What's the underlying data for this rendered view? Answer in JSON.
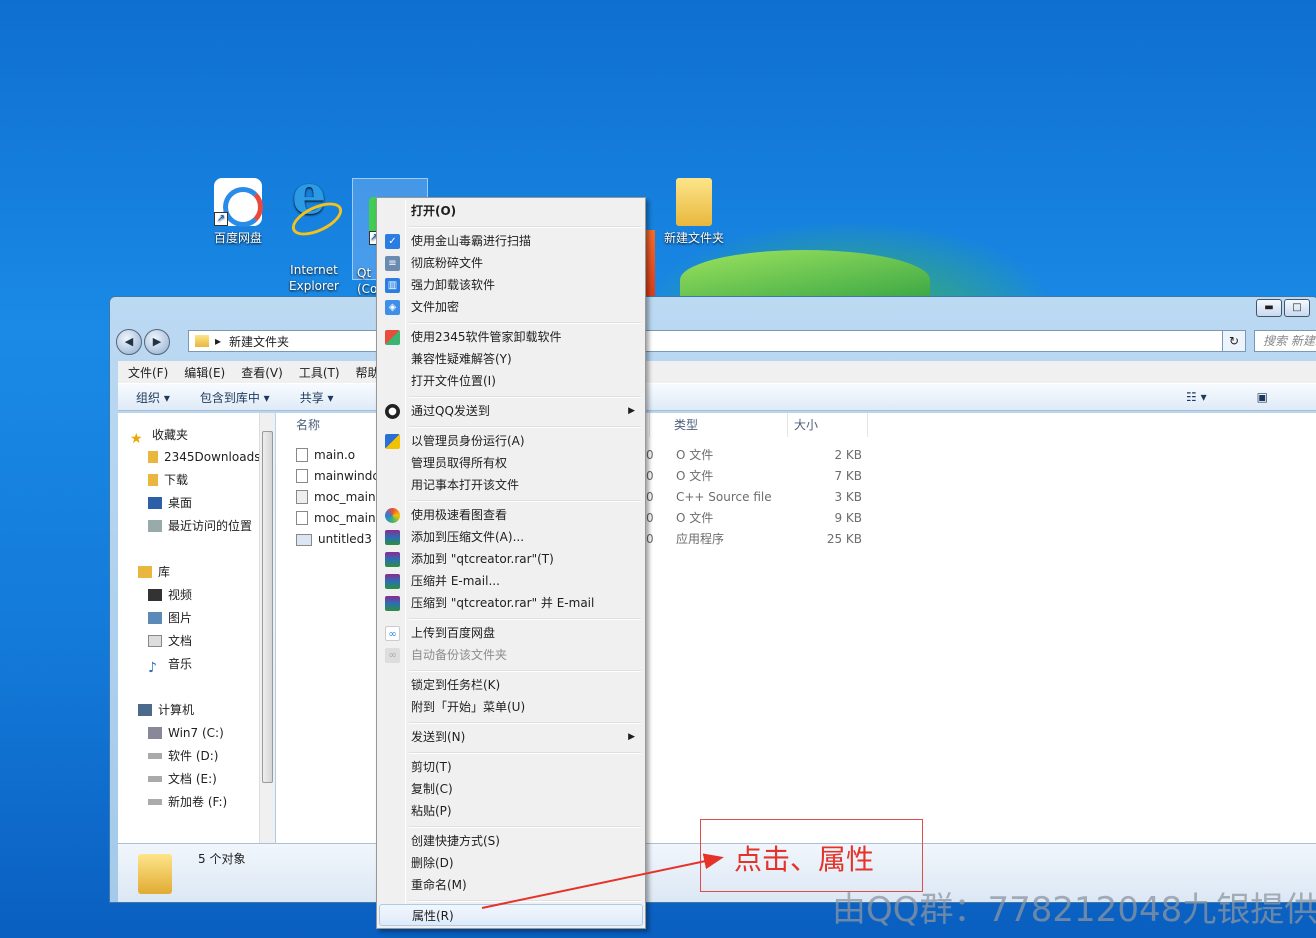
{
  "desktop": {
    "icons": [
      {
        "label": "百度网盘"
      },
      {
        "label": "Internet\nExplorer"
      },
      {
        "label": "Qt\n(Co"
      },
      {
        "label": "新建文件夹"
      }
    ]
  },
  "window": {
    "address_folder": "新建文件夹",
    "search_placeholder": "搜索 新建...",
    "controls": {
      "minimize": "▬",
      "maximize": "□"
    },
    "refresh_glyph": "↻",
    "menubar": [
      "文件(F)",
      "编辑(E)",
      "查看(V)",
      "工具(T)",
      "帮助("
    ],
    "toolbar": [
      "组织 ▾",
      "包含到库中 ▾",
      "共享 ▾"
    ],
    "nav": {
      "favorites": "收藏夹",
      "fav_items": [
        "2345Downloads",
        "下载",
        "桌面",
        "最近访问的位置"
      ],
      "library": "库",
      "lib_items": [
        "视频",
        "图片",
        "文档",
        "音乐"
      ],
      "computer": "计算机",
      "drives": [
        "Win7 (C:)",
        "软件 (D:)",
        "文档 (E:)",
        "新加卷 (F:)"
      ]
    },
    "columns": {
      "name": "名称",
      "type": "类型",
      "size": "大小"
    },
    "files": [
      {
        "name": "main.o",
        "date": "0",
        "type": "O 文件",
        "size": "2 KB"
      },
      {
        "name": "mainwindc",
        "date": "0",
        "type": "O 文件",
        "size": "7 KB"
      },
      {
        "name": "moc_mainv",
        "date": "0",
        "type": "C++ Source file",
        "size": "3 KB"
      },
      {
        "name": "moc_mainv",
        "date": "0",
        "type": "O 文件",
        "size": "9 KB"
      },
      {
        "name": "untitled3",
        "date": "0",
        "type": "应用程序",
        "size": "25 KB"
      }
    ],
    "status": "5 个对象"
  },
  "context_menu": {
    "open": "打开(O)",
    "g1": [
      "使用金山毒霸进行扫描",
      "彻底粉碎文件",
      "强力卸载该软件",
      "文件加密"
    ],
    "g2": [
      "使用2345软件管家卸载软件",
      "兼容性疑难解答(Y)",
      "打开文件位置(I)"
    ],
    "qq": "通过QQ发送到",
    "g3": [
      "以管理员身份运行(A)",
      "管理员取得所有权",
      "用记事本打开该文件"
    ],
    "g4": [
      "使用极速看图查看",
      "添加到压缩文件(A)...",
      "添加到 \"qtcreator.rar\"(T)",
      "压缩并 E-mail...",
      "压缩到 \"qtcreator.rar\" 并 E-mail"
    ],
    "g5": [
      "上传到百度网盘",
      "自动备份该文件夹"
    ],
    "g6": [
      "锁定到任务栏(K)",
      "附到「开始」菜单(U)"
    ],
    "sendto": "发送到(N)",
    "g7": [
      "剪切(T)",
      "复制(C)",
      "粘贴(P)"
    ],
    "g8": [
      "创建快捷方式(S)",
      "删除(D)",
      "重命名(M)"
    ],
    "properties": "属性(R)"
  },
  "annotation": {
    "text": "点击、属性",
    "color": "#e6332a"
  },
  "watermark": "由QQ群：778212048九银提供"
}
